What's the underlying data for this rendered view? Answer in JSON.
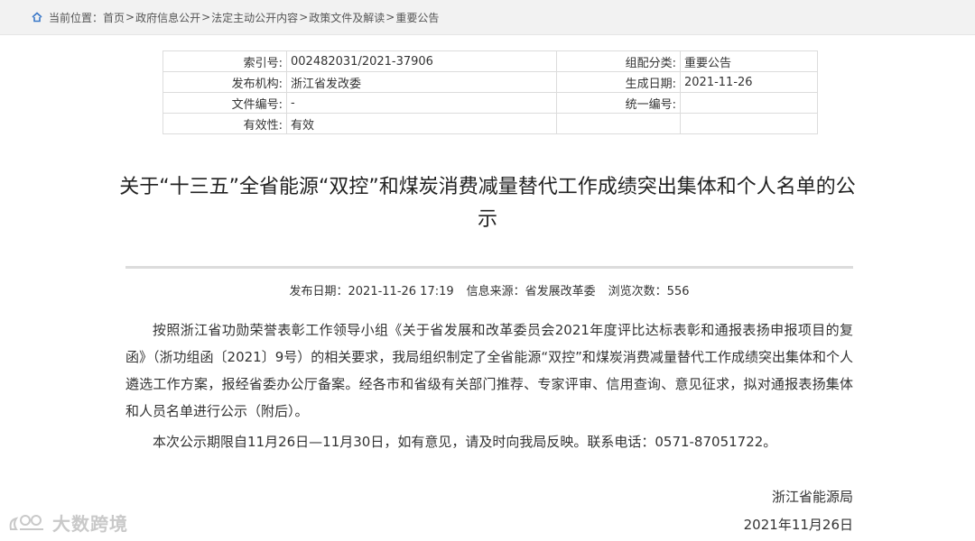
{
  "breadcrumb": {
    "label": "当前位置：",
    "items": [
      "首页",
      "政府信息公开",
      "法定主动公开内容",
      "政策文件及解读",
      "重要公告"
    ],
    "separator": ">"
  },
  "meta": {
    "index_key": "索引号:",
    "index_val": "002482031/2021-37906",
    "category_key": "组配分类:",
    "category_val": "重要公告",
    "publisher_key": "发布机构:",
    "publisher_val": "浙江省发改委",
    "created_key": "生成日期:",
    "created_val": "2021-11-26",
    "docno_key": "文件编号:",
    "docno_val": "-",
    "unified_key": "统一编号:",
    "unified_val": "",
    "validity_key": "有效性:",
    "validity_val": "有效"
  },
  "article": {
    "title": "关于“十三五”全省能源“双控”和煤炭消费减量替代工作成绩突出集体和个人名单的公示",
    "publish_date": "发布日期：2021-11-26 17:19",
    "source": "信息来源：省发展改革委",
    "views": "浏览次数：556",
    "para1": "按照浙江省功勋荣誉表彰工作领导小组《关于省发展和改革委员会2021年度评比达标表彰和通报表扬申报项目的复函》（浙功组函〔2021〕9号）的相关要求，我局组织制定了全省能源“双控”和煤炭消费减量替代工作成绩突出集体和个人遴选工作方案，报经省委办公厅备案。经各市和省级有关部门推荐、专家评审、信用查询、意见征求，拟对通报表扬集体和人员名单进行公示（附后）。",
    "para2": "本次公示期限自11月26日—11月30日，如有意见，请及时向我局反映。联系电话：0571-87051722。",
    "sign_org": "浙江省能源局",
    "sign_date": "2021年11月26日"
  },
  "watermark": {
    "text": "大数跨境"
  },
  "colors": {
    "breadcrumb_bg": "#f2f2f2",
    "home_icon": "#3a78c8",
    "divider": "#dcdcdc"
  }
}
